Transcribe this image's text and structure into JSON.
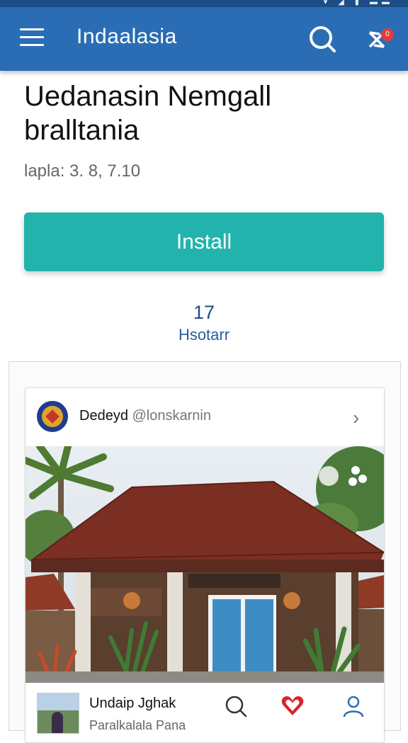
{
  "appbar": {
    "title": "Indaalasia",
    "notification_count": "0"
  },
  "app": {
    "name_line1": "Uedanasin Nemgall",
    "name_line2": "bralltania",
    "version": "lapla: 3. 8, 7.10"
  },
  "install_label": "Install",
  "stats": {
    "count": "17",
    "label": "Hsotarr"
  },
  "post": {
    "author": "Dedeyd",
    "handle": "@lonskarnin",
    "footer_title": "Undaip Jghak",
    "footer_subtitle": "Paralkalala Pana",
    "actions": [
      {
        "icon": "search-icon",
        "color": "#333333"
      },
      {
        "icon": "heart-icon",
        "color": "#d6262f"
      },
      {
        "icon": "user-icon",
        "color": "#2a6db4"
      }
    ]
  },
  "colors": {
    "appbar": "#2a6db4",
    "install": "#23b3ad",
    "stats": "#224b84"
  }
}
